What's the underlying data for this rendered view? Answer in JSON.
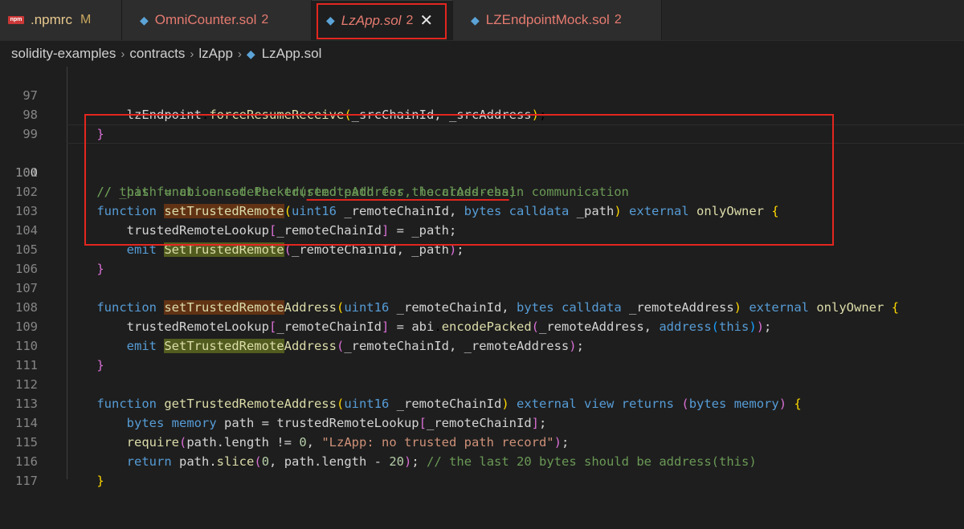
{
  "tabs": [
    {
      "label": ".npmrc",
      "badge": "M",
      "icon": "npm-icon"
    },
    {
      "label": "OmniCounter.sol",
      "badge": "2",
      "icon": "solidity-icon"
    },
    {
      "label": "LzApp.sol",
      "badge": "2",
      "icon": "solidity-icon",
      "active": true,
      "close": "✕"
    },
    {
      "label": "LZEndpointMock.sol",
      "badge": "2",
      "icon": "solidity-icon"
    }
  ],
  "breadcrumb": [
    "solidity-examples",
    "contracts",
    "lzApp",
    "LzApp.sol"
  ],
  "active_line": "100",
  "highlight_color": "#e3261f",
  "lines": [
    {
      "n": "97",
      "text": "        lzEndpoint.forceResumeReceive(_srcChainId, _srcAddress);"
    },
    {
      "n": "98",
      "text": "    }"
    },
    {
      "n": "99",
      "text": ""
    },
    {
      "n": "100",
      "text": "    // _path = abi.encodePacked(remoteAddress, localAddress)"
    },
    {
      "n": "101",
      "text": "    // this function set the trusted path for the cross-chain communication"
    },
    {
      "n": "102",
      "text": "    function setTrustedRemote(uint16 _remoteChainId, bytes calldata _path) external onlyOwner {"
    },
    {
      "n": "103",
      "text": "        trustedRemoteLookup[_remoteChainId] = _path;"
    },
    {
      "n": "104",
      "text": "        emit SetTrustedRemote(_remoteChainId, _path);"
    },
    {
      "n": "105",
      "text": "    }"
    },
    {
      "n": "106",
      "text": ""
    },
    {
      "n": "107",
      "text": "    function setTrustedRemoteAddress(uint16 _remoteChainId, bytes calldata _remoteAddress) external onlyOwner {"
    },
    {
      "n": "108",
      "text": "        trustedRemoteLookup[_remoteChainId] = abi.encodePacked(_remoteAddress, address(this));"
    },
    {
      "n": "109",
      "text": "        emit SetTrustedRemoteAddress(_remoteChainId, _remoteAddress);"
    },
    {
      "n": "110",
      "text": "    }"
    },
    {
      "n": "111",
      "text": ""
    },
    {
      "n": "112",
      "text": "    function getTrustedRemoteAddress(uint16 _remoteChainId) external view returns (bytes memory) {"
    },
    {
      "n": "113",
      "text": "        bytes memory path = trustedRemoteLookup[_remoteChainId];"
    },
    {
      "n": "114",
      "text": "        require(path.length != 0, \"LzApp: no trusted path record\");"
    },
    {
      "n": "115",
      "text": "        return path.slice(0, path.length - 20); // the last 20 bytes should be address(this)"
    },
    {
      "n": "116",
      "text": "    }"
    },
    {
      "n": "117",
      "text": ""
    }
  ]
}
